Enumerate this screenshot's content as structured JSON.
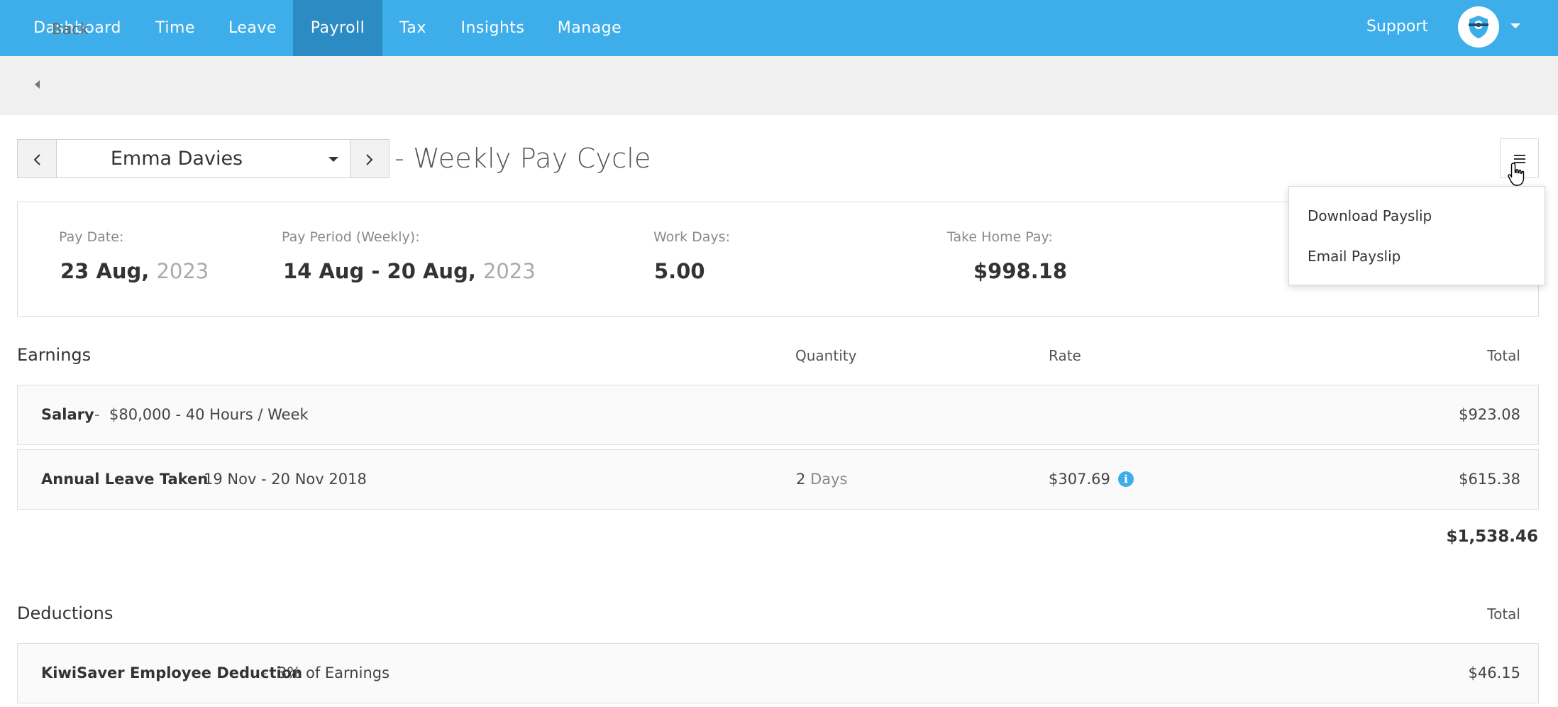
{
  "nav": {
    "items": [
      {
        "label": "Dashboard",
        "active": false
      },
      {
        "label": "Time",
        "active": false
      },
      {
        "label": "Leave",
        "active": false
      },
      {
        "label": "Payroll",
        "active": true
      },
      {
        "label": "Tax",
        "active": false
      },
      {
        "label": "Insights",
        "active": false
      },
      {
        "label": "Manage",
        "active": false
      }
    ],
    "support": "Support",
    "brand_color": "#3daee9",
    "active_color": "#2b8bc2"
  },
  "back": {
    "label": "Back"
  },
  "employee": {
    "name": "Emma Davies",
    "cycle": "- Weekly Pay Cycle"
  },
  "menu": {
    "items": [
      "Download Payslip",
      "Email Payslip"
    ]
  },
  "summary": {
    "pay_date_label": "Pay Date:",
    "pay_date_main": "23 Aug,",
    "pay_date_year": "2023",
    "period_label": "Pay Period (Weekly):",
    "period_main": "14 Aug - 20 Aug,",
    "period_year": "2023",
    "workdays_label": "Work Days:",
    "workdays_value": "5.00",
    "takehome_label": "Take Home Pay:",
    "takehome_value": "$998.18"
  },
  "earnings": {
    "title": "Earnings",
    "col_quantity": "Quantity",
    "col_rate": "Rate",
    "col_total": "Total",
    "rows": [
      {
        "name": "Salary",
        "sep": "-",
        "desc": "$80,000 - 40 Hours / Week",
        "qty": "",
        "qty_unit": "",
        "rate": "",
        "total": "$923.08"
      },
      {
        "name": "Annual Leave Taken",
        "sep": "-",
        "desc": "19 Nov - 20 Nov 2018",
        "qty": "2",
        "qty_unit": "Days",
        "rate": "$307.69",
        "total": "$615.38"
      }
    ],
    "grand_total": "$1,538.46"
  },
  "deductions": {
    "title": "Deductions",
    "col_total": "Total",
    "rows": [
      {
        "name": "KiwiSaver Employee Deduction",
        "sep": "-",
        "desc": "3% of Earnings",
        "total": "$46.15"
      }
    ]
  }
}
